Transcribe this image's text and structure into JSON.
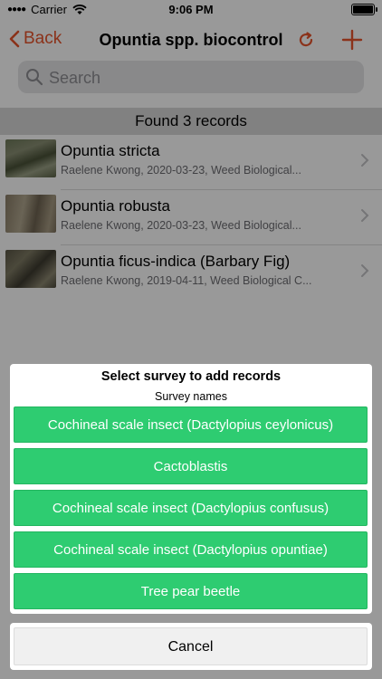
{
  "status_bar": {
    "carrier": "Carrier",
    "time": "9:06 PM"
  },
  "nav": {
    "back_label": "Back",
    "title": "Opuntia spp. biocontrol"
  },
  "search": {
    "placeholder": "Search"
  },
  "results_header": "Found 3 records",
  "records": [
    {
      "title": "Opuntia stricta",
      "subtitle": "Raelene Kwong, 2020-03-23, Weed Biological..."
    },
    {
      "title": "Opuntia robusta",
      "subtitle": "Raelene Kwong, 2020-03-23, Weed Biological..."
    },
    {
      "title": "Opuntia ficus-indica (Barbary Fig)",
      "subtitle": "Raelene Kwong, 2019-04-11, Weed Biological C..."
    }
  ],
  "action_sheet": {
    "heading": "Select survey to add records",
    "subheading": "Survey names",
    "options": [
      "Cochineal scale insect (Dactylopius ceylonicus)",
      "Cactoblastis",
      "Cochineal scale insect (Dactylopius confusus)",
      "Cochineal scale insect (Dactylopius opuntiae)",
      "Tree pear beetle"
    ],
    "cancel_label": "Cancel"
  },
  "colors": {
    "accent": "#e8542c",
    "option_green": "#2ecc71"
  },
  "icons": [
    "wifi-icon",
    "battery-icon",
    "back-chevron-icon",
    "refresh-icon",
    "add-icon",
    "search-icon",
    "chevron-right-icon"
  ]
}
